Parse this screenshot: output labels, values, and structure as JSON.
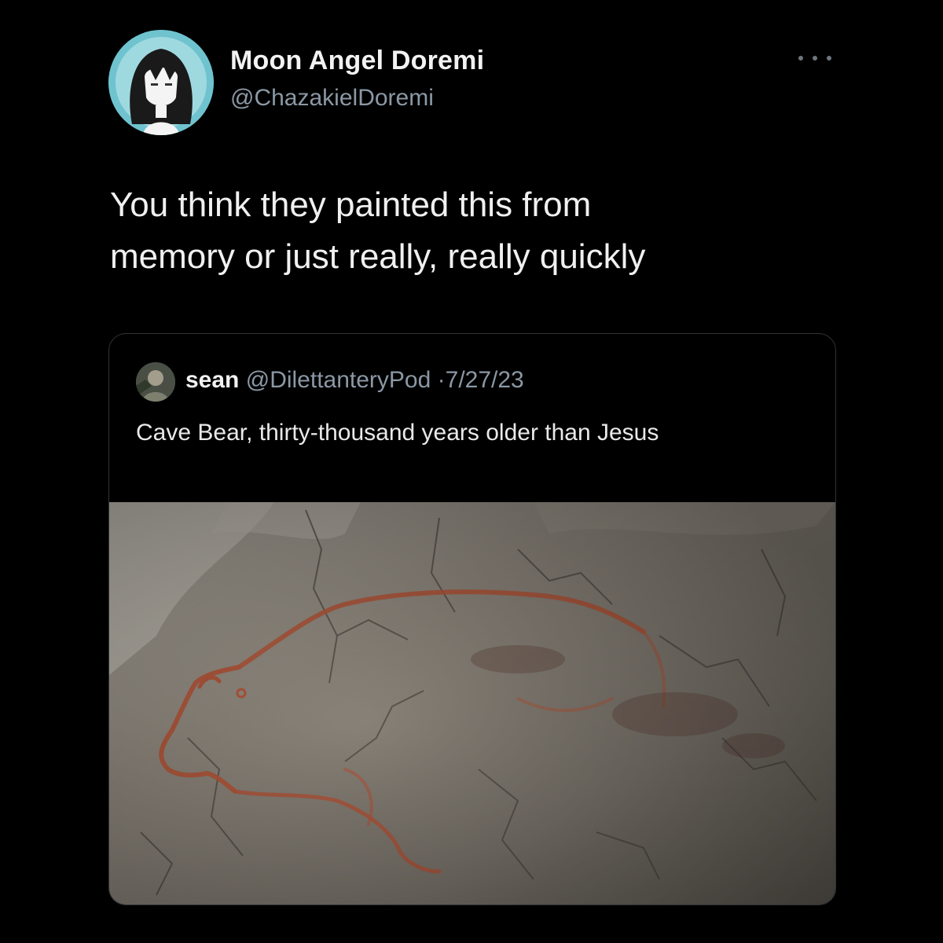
{
  "tweet": {
    "author": {
      "display_name": "Moon Angel Doremi",
      "handle": "@ChazakielDoremi",
      "avatar_icon": "anime-girl-avatar-icon"
    },
    "more_icon": "more-options-icon",
    "text": "You think they painted this from\nmemory or just really, really quickly"
  },
  "quoted_tweet": {
    "author": {
      "display_name": "sean",
      "handle": "@DilettanteryPod",
      "avatar_icon": "profile-avatar-icon"
    },
    "separator": "·",
    "date": "7/27/23",
    "text": "Cave Bear, thirty-thousand years older than Jesus",
    "media": {
      "icon": "cave-bear-painting-image",
      "colors": {
        "rock": "#8d867c",
        "ochre": "#b0553a"
      }
    }
  },
  "colors": {
    "background": "#000000",
    "text_primary": "#e7e9ea",
    "text_secondary": "#8b98a5",
    "border": "#2f3336"
  }
}
